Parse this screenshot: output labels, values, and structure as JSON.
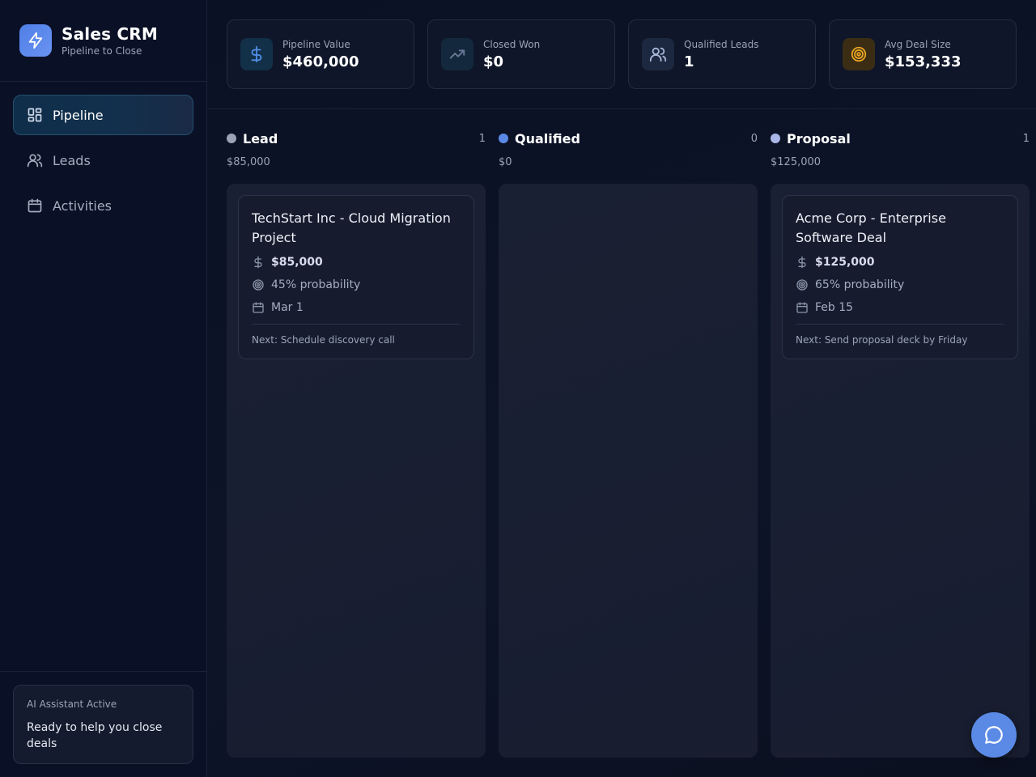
{
  "brand": {
    "title": "Sales CRM",
    "subtitle": "Pipeline to Close",
    "icon": "lightning-icon"
  },
  "nav": {
    "items": [
      {
        "label": "Pipeline",
        "icon": "grid-icon",
        "active": true
      },
      {
        "label": "Leads",
        "icon": "users-icon",
        "active": false
      },
      {
        "label": "Activities",
        "icon": "calendar-icon",
        "active": false
      }
    ]
  },
  "ai": {
    "title": "AI Assistant Active",
    "text": "Ready to help you close deals"
  },
  "stats": [
    {
      "label": "Pipeline Value",
      "value": "$460,000",
      "icon": "dollar-icon",
      "color": "#4f8ee6"
    },
    {
      "label": "Closed Won",
      "value": "$0",
      "icon": "trending-up-icon",
      "color": "#6b7a99"
    },
    {
      "label": "Qualified Leads",
      "value": "1",
      "icon": "users-icon",
      "color": "#a9b6d8"
    },
    {
      "label": "Avg Deal Size",
      "value": "$153,333",
      "icon": "target-icon",
      "color": "#e8a322"
    }
  ],
  "columns": [
    {
      "title": "Lead",
      "count": "1",
      "value": "$85,000",
      "color": "#9ca3b4",
      "deals": [
        {
          "title": "TechStart Inc - Cloud Migration Project",
          "amount": "$85,000",
          "probability": "45% probability",
          "date": "Mar 1",
          "next": "Next: Schedule discovery call"
        }
      ]
    },
    {
      "title": "Qualified",
      "count": "0",
      "value": "$0",
      "color": "#5b8ae6",
      "deals": []
    },
    {
      "title": "Proposal",
      "count": "1",
      "value": "$125,000",
      "color": "#a9b6e8",
      "deals": [
        {
          "title": "Acme Corp - Enterprise Software Deal",
          "amount": "$125,000",
          "probability": "65% probability",
          "date": "Feb 15",
          "next": "Next: Send proposal deck by Friday"
        }
      ]
    }
  ],
  "fab": {
    "icon": "chat-icon"
  }
}
